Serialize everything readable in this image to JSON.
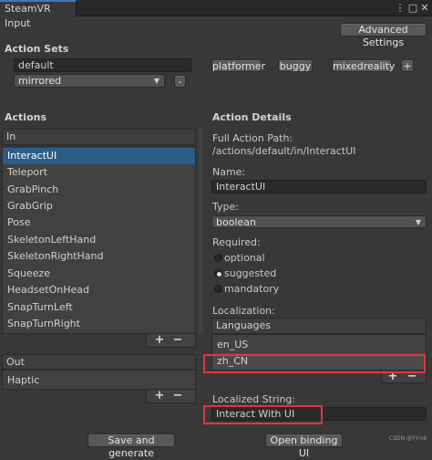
{
  "window": {
    "tab_title": "SteamVR Input",
    "menu_icon": "kebab-menu-icon",
    "maximize_icon": "maximize-icon",
    "close_icon": "close-icon"
  },
  "toolbar": {
    "advanced_settings": "Advanced Settings"
  },
  "action_sets": {
    "header": "Action Sets",
    "selected_name": "default",
    "other_sets": [
      "platformer",
      "buggy",
      "mixedreality"
    ],
    "add_label": "+",
    "mode_value": "mirrored",
    "remove_label": "-"
  },
  "actions": {
    "header": "Actions",
    "in_label": "In",
    "in_items": [
      "InteractUI",
      "Teleport",
      "GrabPinch",
      "GrabGrip",
      "Pose",
      "SkeletonLeftHand",
      "SkeletonRightHand",
      "Squeeze",
      "HeadsetOnHead",
      "SnapTurnLeft",
      "SnapTurnRight"
    ],
    "selected_index": 0,
    "in_add": "+",
    "in_remove": "−",
    "out_label": "Out",
    "out_items": [
      "Haptic"
    ],
    "out_add": "+",
    "out_remove": "−"
  },
  "details": {
    "header": "Action Details",
    "full_path_label": "Full Action Path:",
    "full_path_value": "/actions/default/in/InteractUI",
    "name_label": "Name:",
    "name_value": "InteractUI",
    "type_label": "Type:",
    "type_value": "boolean",
    "required_label": "Required:",
    "required_options": [
      "optional",
      "suggested",
      "mandatory"
    ],
    "required_selected": 1,
    "localization_label": "Localization:",
    "languages_header": "Languages",
    "languages": [
      "en_US",
      "zh_CN"
    ],
    "lang_add": "+",
    "lang_remove": "−",
    "localized_string_label": "Localized String:",
    "localized_string_value": "Interact With UI"
  },
  "footer": {
    "save_generate": "Save and generate",
    "open_binding": "Open binding UI",
    "watermark": "CSDN @YY-nb"
  },
  "colors": {
    "selection": "#2c5d87",
    "highlight": "#e0383c",
    "tab_accent": "#3a79bb"
  }
}
